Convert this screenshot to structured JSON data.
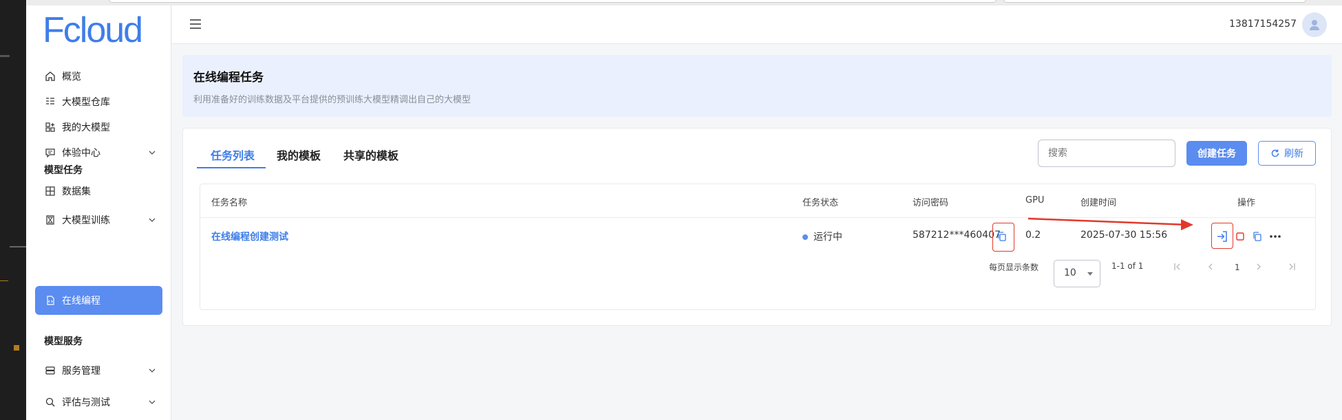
{
  "app": {
    "logo": "Fcloud"
  },
  "sidebar": {
    "items": [
      {
        "label": "概览"
      },
      {
        "label": "大模型仓库"
      },
      {
        "label": "我的大模型"
      },
      {
        "label": "体验中心"
      },
      {
        "label": "数据集"
      },
      {
        "label": "大模型训练"
      },
      {
        "label": "在线编程"
      },
      {
        "label": "服务管理"
      },
      {
        "label": "评估与测试"
      }
    ],
    "sections": {
      "task": "模型任务",
      "service": "模型服务"
    }
  },
  "header": {
    "user": "13817154257"
  },
  "banner": {
    "title": "在线编程任务",
    "subtitle": "利用准备好的训练数据及平台提供的预训练大模型精调出自己的大模型"
  },
  "tabs": [
    {
      "label": "任务列表"
    },
    {
      "label": "我的模板"
    },
    {
      "label": "共享的模板"
    }
  ],
  "toolbar": {
    "search_placeholder": "搜索",
    "create_label": "创建任务",
    "refresh_label": "刷新"
  },
  "table": {
    "headers": {
      "name": "任务名称",
      "status": "任务状态",
      "password": "访问密码",
      "gpu": "GPU",
      "created": "创建时间",
      "actions": "操作"
    },
    "rows": [
      {
        "name": "在线编程创建测试",
        "status": "运行中",
        "password": "587212***460407",
        "gpu": "0.2",
        "created": "2025-07-30 15:56"
      }
    ]
  },
  "pagination": {
    "per_page_label": "每页显示条数",
    "per_page": "10",
    "range": "1-1 of 1",
    "page": "1"
  },
  "colors": {
    "accent": "#3f7ee8",
    "annotation": "#e0392b"
  }
}
